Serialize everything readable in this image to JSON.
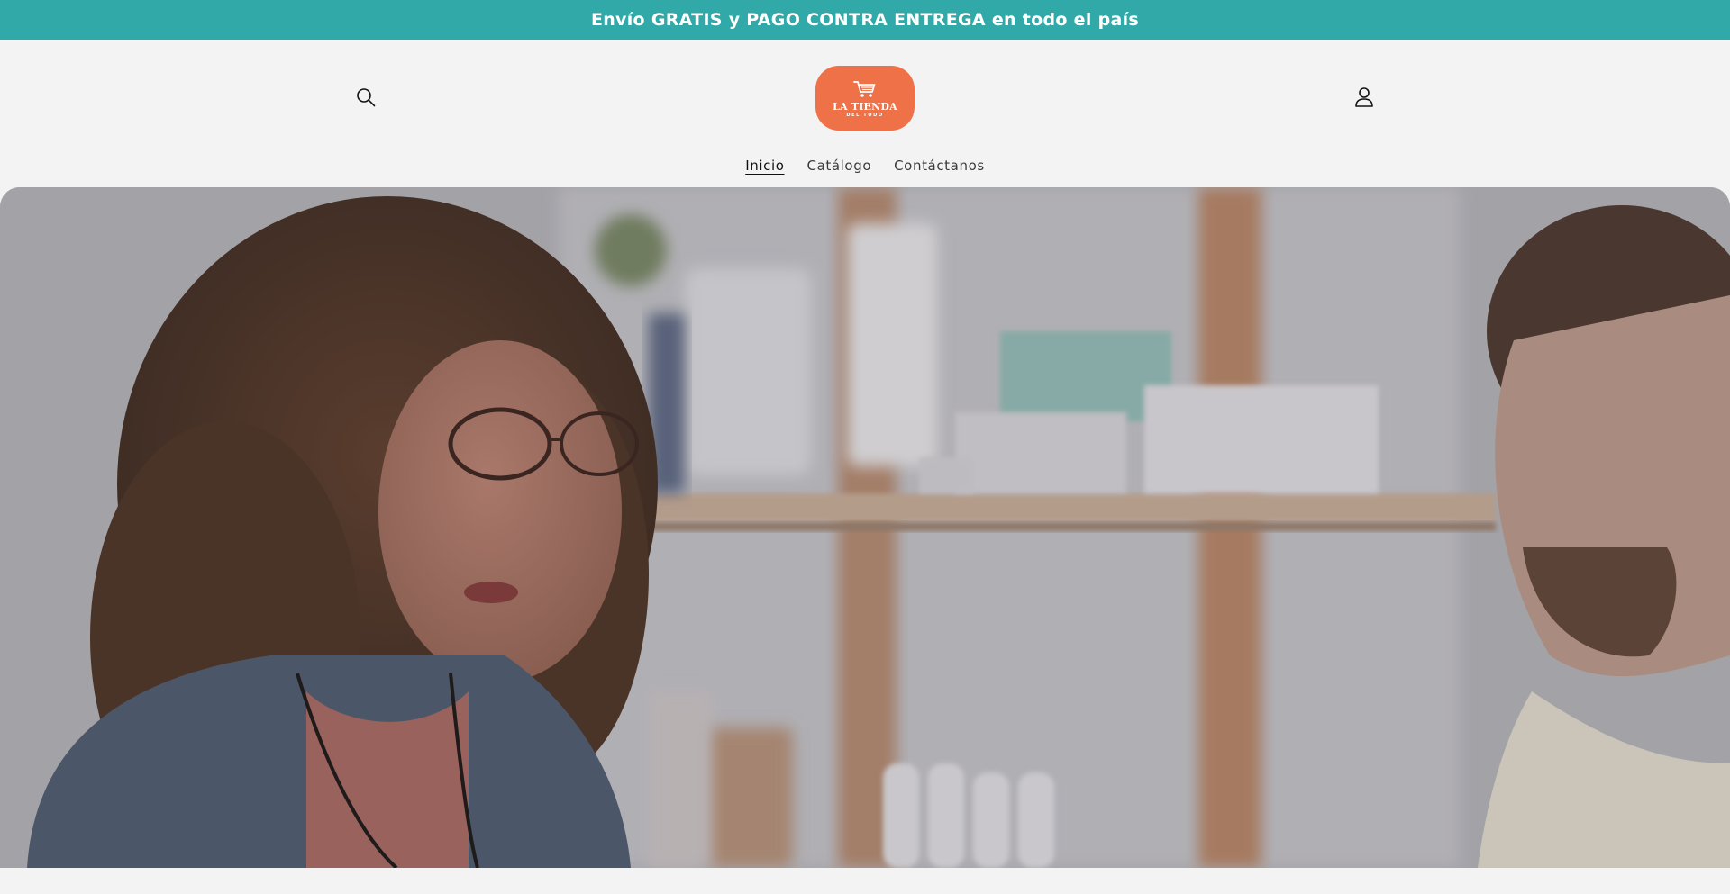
{
  "announcement": {
    "text": "Envío GRATIS y PAGO CONTRA ENTREGA en todo el país"
  },
  "header": {
    "search_icon": "search-icon",
    "account_icon": "user-icon",
    "logo": {
      "icon": "shopping-cart-icon",
      "title": "LA TIENDA",
      "subtitle": "DEL TODO",
      "color": "#ee7148"
    }
  },
  "nav": {
    "items": [
      {
        "label": "Inicio",
        "active": true
      },
      {
        "label": "Catálogo",
        "active": false
      },
      {
        "label": "Contáctanos",
        "active": false
      }
    ]
  },
  "hero": {
    "image": "hero-photo-shop-customers"
  },
  "colors": {
    "announcement_bg": "#31a9a9",
    "page_bg": "#f3f3f3",
    "text": "#121212"
  }
}
